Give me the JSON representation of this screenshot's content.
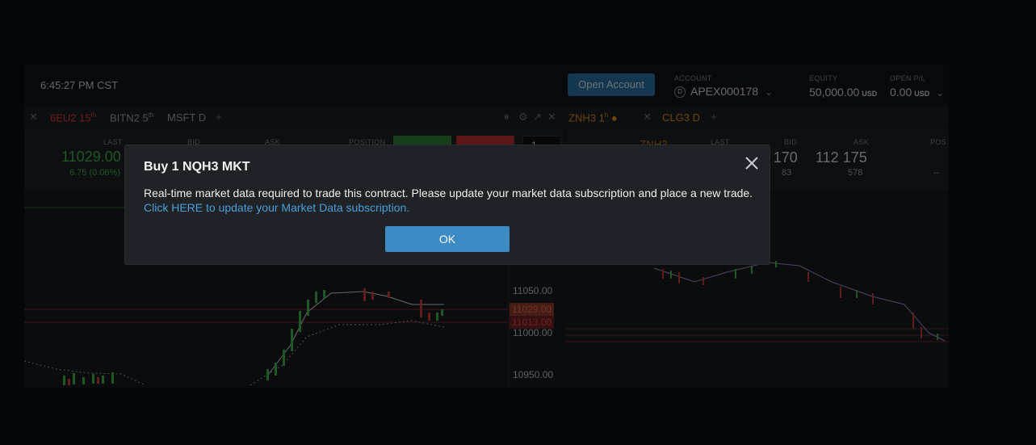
{
  "header": {
    "clock": "6:45:27 PM CST",
    "open_account_label": "Open Account",
    "account_label": "ACCOUNT",
    "account_value": "APEX000178",
    "equity_label": "EQUITY",
    "equity_value": "50,000.00",
    "equity_unit": "USD",
    "open_pl_label": "OPEN P/L",
    "open_pl_value": "0.00",
    "open_pl_unit": "USD"
  },
  "left_tabs": [
    {
      "label": "6EU2 15",
      "sup": "th"
    },
    {
      "label": "BITN2 5",
      "sup": "th"
    },
    {
      "label": "MSFT D",
      "sup": ""
    }
  ],
  "right_tabs": [
    {
      "label": "ZNH3 1",
      "sup": "h"
    },
    {
      "label": "CLG3 D",
      "sup": ""
    }
  ],
  "left_quote": {
    "last_label": "LAST",
    "bid_label": "BID",
    "ask_label": "ASK",
    "position_label": "POSITION",
    "last_value": "11029.00",
    "change": "6.75 (0.06%)",
    "qty": "1"
  },
  "right_quote": {
    "symbol": "ZNH3",
    "last_label": "LAST",
    "bid_label": "BID",
    "ask_label": "ASK",
    "pos_label": "POS",
    "bid_value": "112 170",
    "ask_value": "112 175",
    "bid_size": "83",
    "ask_size": "578",
    "pos_value": "--"
  },
  "left_chart": {
    "price_labels": [
      "11050.00",
      "11000.00",
      "10950.00"
    ],
    "tags": [
      "11029.00",
      "11013.00"
    ]
  },
  "dialog": {
    "title": "Buy 1 NQH3 MKT",
    "message": "Real-time market data required to trade this contract. Please update your market data subscription and place a new trade.",
    "link": "Click HERE to update your Market Data subscription.",
    "ok_label": "OK"
  },
  "colors": {
    "accent_blue": "#3e8ac3",
    "link_blue": "#4a9fd8",
    "green": "#3fae4b",
    "red": "#e03a32"
  }
}
